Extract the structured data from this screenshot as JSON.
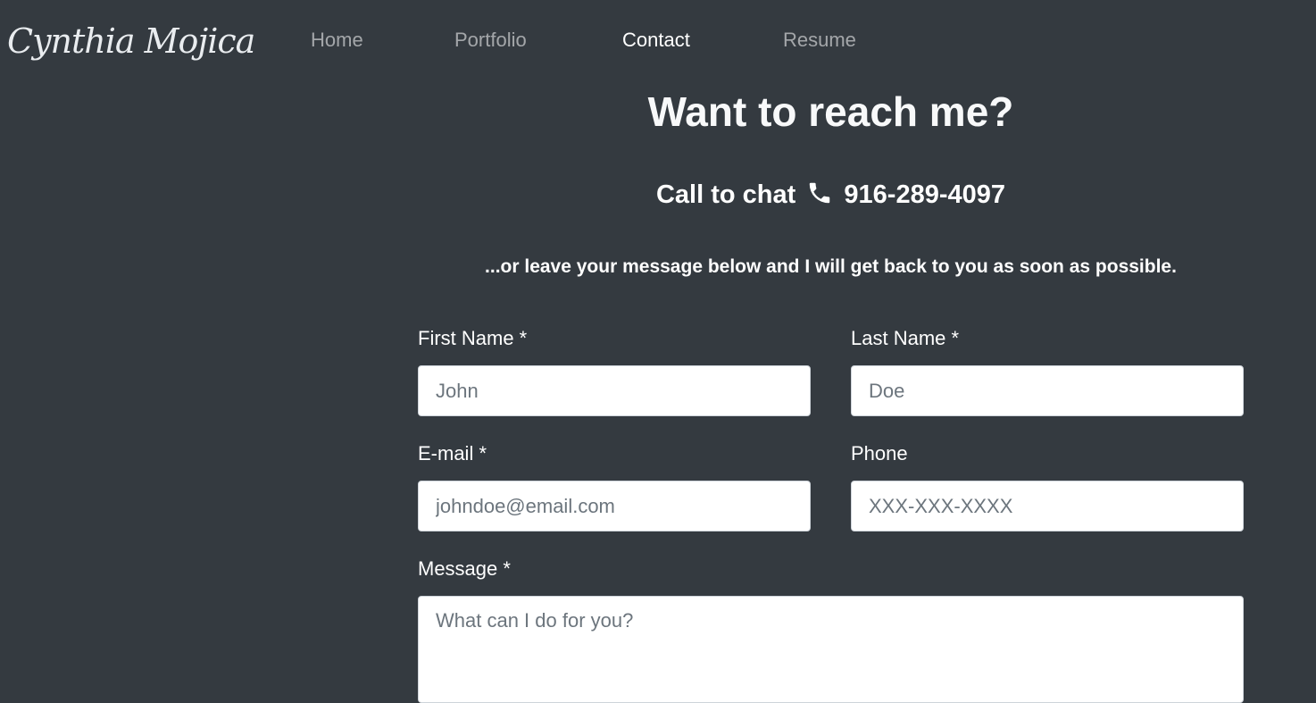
{
  "navbar": {
    "brand": "Cynthia Mojica",
    "links": [
      {
        "label": "Home",
        "active": false
      },
      {
        "label": "Portfolio",
        "active": false
      },
      {
        "label": "Contact",
        "active": true
      },
      {
        "label": "Resume",
        "active": false
      }
    ]
  },
  "contact": {
    "heading": "Want to reach me?",
    "call_prefix": "Call to chat",
    "phone_icon": "phone-icon",
    "phone_number": "916-289-4097",
    "leave_message": "...or leave your message below and I will get back to you as soon as possible."
  },
  "form": {
    "first_name": {
      "label": "First Name *",
      "placeholder": "John",
      "value": ""
    },
    "last_name": {
      "label": "Last Name *",
      "placeholder": "Doe",
      "value": ""
    },
    "email": {
      "label": "E-mail *",
      "placeholder": "johndoe@email.com",
      "value": ""
    },
    "phone": {
      "label": "Phone",
      "placeholder": "XXX-XXX-XXXX",
      "value": ""
    },
    "message": {
      "label": "Message *",
      "placeholder": "What can I do for you?",
      "value": ""
    }
  },
  "colors": {
    "background": "#343a40",
    "nav_inactive": "#9fa3a6",
    "nav_active": "#ffffff",
    "input_background": "#ffffff",
    "placeholder": "#6c757d"
  }
}
